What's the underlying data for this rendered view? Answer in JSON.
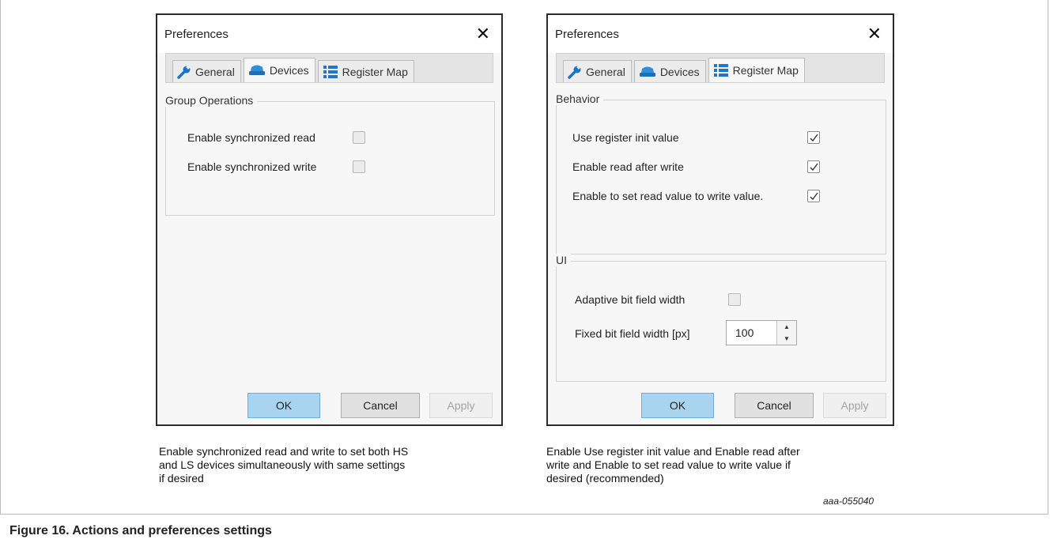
{
  "left_dialog": {
    "title": "Preferences",
    "close_glyph": "✕",
    "tabs": [
      {
        "label": "General",
        "icon": "wrench-icon",
        "active": false
      },
      {
        "label": "Devices",
        "icon": "devices-icon",
        "active": true
      },
      {
        "label": "Register Map",
        "icon": "register-map-icon",
        "active": false
      }
    ],
    "group": {
      "label": "Group Operations",
      "items": [
        {
          "label": "Enable synchronized read",
          "checked": false
        },
        {
          "label": "Enable synchronized write",
          "checked": false
        }
      ]
    },
    "buttons": {
      "ok": "OK",
      "cancel": "Cancel",
      "apply": "Apply"
    }
  },
  "right_dialog": {
    "title": "Preferences",
    "close_glyph": "✕",
    "tabs": [
      {
        "label": "General",
        "icon": "wrench-icon",
        "active": false
      },
      {
        "label": "Devices",
        "icon": "devices-icon",
        "active": false
      },
      {
        "label": "Register Map",
        "icon": "register-map-icon",
        "active": true
      }
    ],
    "behavior_group": {
      "label": "Behavior",
      "items": [
        {
          "label": "Use register init value",
          "checked": true
        },
        {
          "label": "Enable read after write",
          "checked": true
        },
        {
          "label": "Enable to set read value to write value.",
          "checked": true
        }
      ]
    },
    "ui_group": {
      "label": "UI",
      "adaptive_label": "Adaptive bit field width",
      "adaptive_checked": false,
      "fixed_label": "Fixed bit field width [px]",
      "fixed_value": "100"
    },
    "buttons": {
      "ok": "OK",
      "cancel": "Cancel",
      "apply": "Apply"
    }
  },
  "captions": {
    "left": "Enable synchronized read and write to set both HS\nand LS devices simultaneously with same settings\nif desired",
    "right": "Enable Use register init value and Enable read after\nwrite and Enable to set read value to write value if\ndesired (recommended)"
  },
  "figure_id": "aaa-055040",
  "figure_title": "Figure 16.  Actions and preferences settings",
  "colors": {
    "wrench": "#1a73c8",
    "devices": "#2f8fd8",
    "register_map": "#1f76cf",
    "ok_button": "#a8d4ef"
  }
}
